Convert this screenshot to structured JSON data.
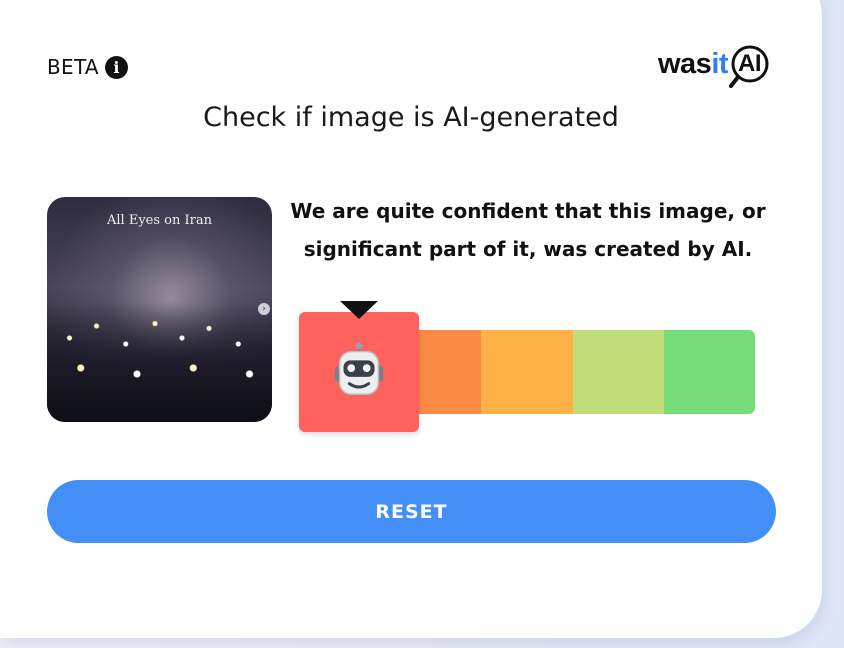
{
  "header": {
    "beta_label": "BETA",
    "info_icon": "info-icon",
    "logo": {
      "was": "was",
      "it": "it",
      "ai": "AI"
    }
  },
  "title": "Check if image is AI-generated",
  "image": {
    "caption": "All Eyes on Iran"
  },
  "result": {
    "verdict": "We are quite confident that this image, or significant part of it, was created by AI.",
    "meter": {
      "segments": 5,
      "selected_index": 0,
      "selected_icon": "robot-icon",
      "colors": [
        "#f05f5b",
        "#f98a45",
        "#feb147",
        "#c0de79",
        "#76db78"
      ],
      "marker_color": "#ff625d"
    }
  },
  "actions": {
    "reset_label": "RESET",
    "reset_color": "#438ef7"
  }
}
